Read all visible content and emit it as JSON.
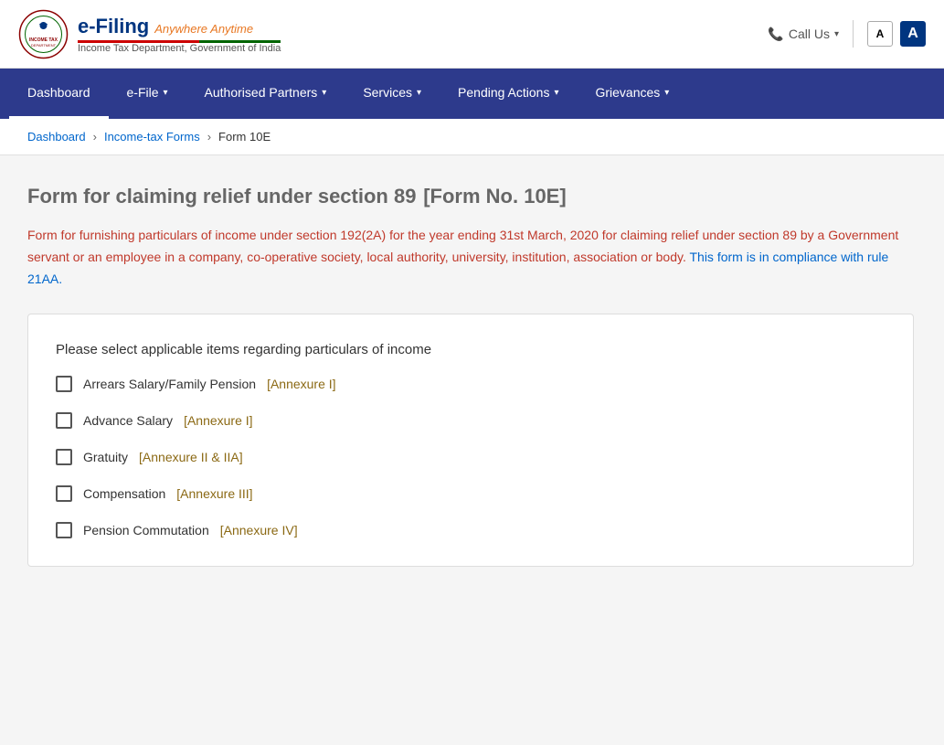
{
  "header": {
    "brand_main": "e-Filing",
    "brand_tagline": "Anywhere Anytime",
    "brand_subtitle": "Income Tax Department, Government of India",
    "call_us": "Call Us",
    "font_small": "A",
    "font_large": "A"
  },
  "nav": {
    "items": [
      {
        "id": "dashboard",
        "label": "Dashboard",
        "active": true,
        "hasDropdown": false
      },
      {
        "id": "efile",
        "label": "e-File",
        "active": false,
        "hasDropdown": true
      },
      {
        "id": "authorised-partners",
        "label": "Authorised Partners",
        "active": false,
        "hasDropdown": true
      },
      {
        "id": "services",
        "label": "Services",
        "active": false,
        "hasDropdown": true
      },
      {
        "id": "pending-actions",
        "label": "Pending Actions",
        "active": false,
        "hasDropdown": true
      },
      {
        "id": "grievances",
        "label": "Grievances",
        "active": false,
        "hasDropdown": true
      }
    ]
  },
  "breadcrumb": {
    "items": [
      {
        "label": "Dashboard",
        "link": true
      },
      {
        "label": "Income-tax Forms",
        "link": true
      },
      {
        "label": "Form 10E",
        "link": false
      }
    ]
  },
  "page": {
    "title_main": "Form for claiming relief under section 89",
    "title_suffix": "[Form No. 10E]",
    "description": "Form for furnishing particulars of income under section 192(2A) for the year ending 31st March, 2020 for claiming relief under section 89 by a Government servant or an employee in a company, co-operative society, local authority, university, institution, association or body.",
    "compliance_text": "This form is in compliance with rule 21AA.",
    "section_title": "Please select applicable items regarding particulars of income",
    "checkboxes": [
      {
        "id": "arrears-salary",
        "label_text": "Arrears Salary/Family Pension",
        "label_annexure": "[Annexure I]"
      },
      {
        "id": "advance-salary",
        "label_text": "Advance Salary",
        "label_annexure": "[Annexure I]"
      },
      {
        "id": "gratuity",
        "label_text": "Gratuity",
        "label_annexure": "[Annexure II & IIA]"
      },
      {
        "id": "compensation",
        "label_text": "Compensation",
        "label_annexure": "[Annexure III]"
      },
      {
        "id": "pension-commutation",
        "label_text": "Pension Commutation",
        "label_annexure": "[Annexure IV]"
      }
    ]
  }
}
